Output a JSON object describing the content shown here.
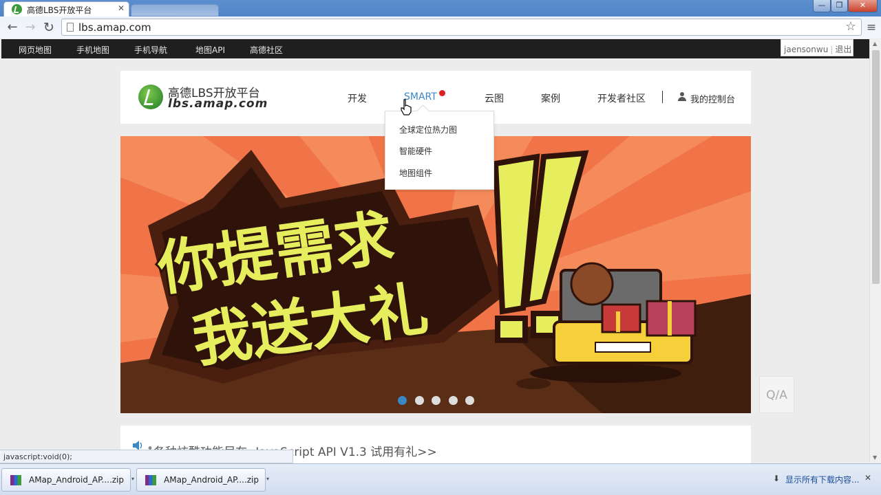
{
  "browser": {
    "active_tab_title": "高德LBS开放平台",
    "tab_close": "✕",
    "url": "lbs.amap.com",
    "window_min": "—",
    "window_max": "❐",
    "window_close": "✕"
  },
  "topbar": {
    "links": [
      "网页地图",
      "手机地图",
      "手机导航",
      "地图API",
      "高德社区"
    ],
    "user": "jaensonwu",
    "separator": "|",
    "logout": "退出"
  },
  "header": {
    "logo_cn": "高德LBS开放平台",
    "logo_en": "lbs.amap.com",
    "nav": [
      "开发",
      "SMART",
      "云图",
      "案例",
      "开发者社区"
    ],
    "console": "我的控制台"
  },
  "dropdown": {
    "items": [
      "全球定位热力图",
      "智能硬件",
      "地图组件"
    ]
  },
  "banner": {
    "line1": "你提需求",
    "line2": "我送大礼",
    "slide_count": 5,
    "active_slide": 1
  },
  "qa_label": "Q/A",
  "notice": {
    "bullet": "•",
    "text": "各种炫酷功能尽在--JavaScript API V1.3 试用有礼>>"
  },
  "status_bar": "javascript:void(0);",
  "downloads": {
    "items": [
      "AMap_Android_AP....zip",
      "AMap_Android_AP....zip"
    ],
    "show_all": "显示所有下载内容...",
    "close": "✕"
  },
  "colors": {
    "accent_blue": "#3b87c4",
    "banner_orange": "#f07447",
    "dark_topbar": "#1f1f1f",
    "slogan_yellow": "#e6ee5e"
  }
}
